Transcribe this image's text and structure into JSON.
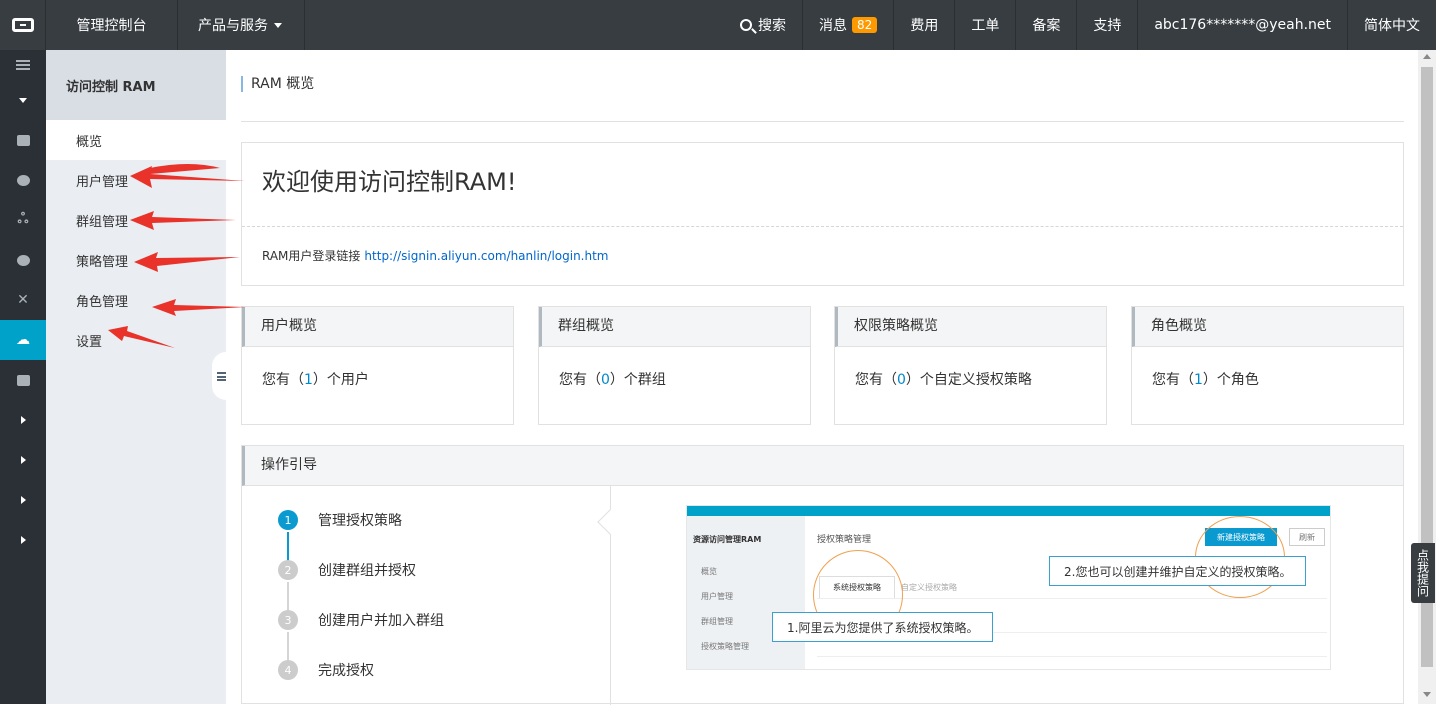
{
  "topbar": {
    "console": "管理控制台",
    "products": "产品与服务",
    "search": "搜索",
    "messages": "消息",
    "message_count": "82",
    "billing": "费用",
    "tickets": "工单",
    "icp": "备案",
    "support": "支持",
    "account": "abc176*******@yeah.net",
    "language": "简体中文"
  },
  "sidebar": {
    "title": "访问控制 RAM",
    "items": [
      {
        "label": "概览"
      },
      {
        "label": "用户管理"
      },
      {
        "label": "群组管理"
      },
      {
        "label": "策略管理"
      },
      {
        "label": "角色管理"
      },
      {
        "label": "设置"
      }
    ]
  },
  "main": {
    "breadcrumb": "RAM 概览",
    "welcome_title": "欢迎使用访问控制RAM!",
    "login_label": "RAM用户登录链接",
    "login_url": "http://signin.aliyun.com/hanlin/login.htm",
    "cards": [
      {
        "title": "用户概览",
        "prefix": "您有（",
        "count": "1",
        "suffix": "）个用户"
      },
      {
        "title": "群组概览",
        "prefix": "您有（",
        "count": "0",
        "suffix": "）个群组"
      },
      {
        "title": "权限策略概览",
        "prefix": "您有（",
        "count": "0",
        "suffix": "）个自定义授权策略"
      },
      {
        "title": "角色概览",
        "prefix": "您有（",
        "count": "1",
        "suffix": "）个角色"
      }
    ],
    "guide": {
      "title": "操作引导",
      "steps": [
        {
          "num": "1",
          "label": "管理授权策略"
        },
        {
          "num": "2",
          "label": "创建群组并授权"
        },
        {
          "num": "3",
          "label": "创建用户并加入群组"
        },
        {
          "num": "4",
          "label": "完成授权"
        }
      ],
      "screenshot": {
        "side_title": "资源访问管理RAM",
        "side_items": [
          "概览",
          "用户管理",
          "群组管理",
          "授权策略管理"
        ],
        "page_title": "授权策略管理",
        "new_button": "新建授权策略",
        "refresh_button": "刷新",
        "tab_active": "系统授权策略",
        "tab_other": "自定义授权策略",
        "callout1": "1.阿里云为您提供了系统授权策略。",
        "callout2": "2.您也可以创建并维护自定义的授权策略。"
      }
    }
  },
  "hint": "点我提问",
  "colors": {
    "topbar": "#373d41",
    "accent": "#00a2ca",
    "badge": "#ff9900",
    "arrow": "#e8322a"
  }
}
